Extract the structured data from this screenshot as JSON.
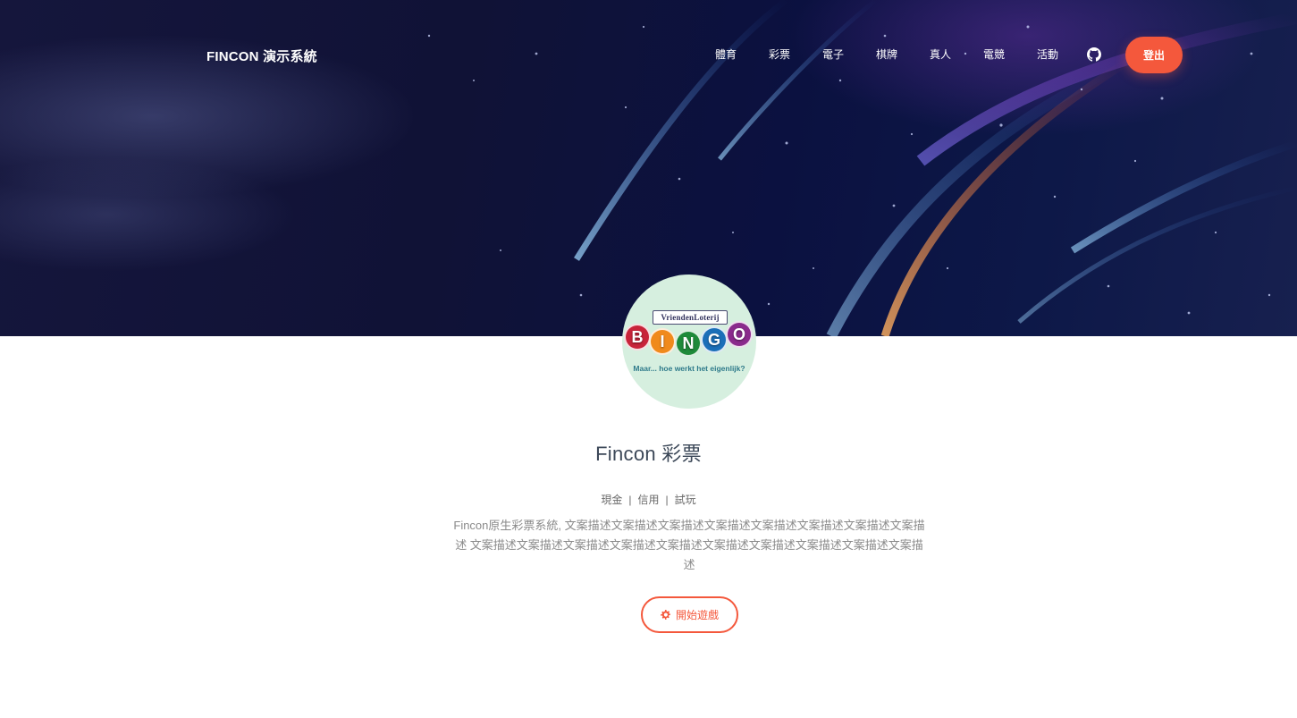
{
  "brand": {
    "name": "FINCON 演示系統"
  },
  "nav": {
    "items": [
      {
        "label": "體育"
      },
      {
        "label": "彩票"
      },
      {
        "label": "電子"
      },
      {
        "label": "棋牌"
      },
      {
        "label": "真人"
      },
      {
        "label": "電競"
      },
      {
        "label": "活動"
      }
    ],
    "github_icon": "github-icon",
    "logout_label": "登出"
  },
  "avatar": {
    "top_text": "VriendenLoterij",
    "balls": [
      "B",
      "I",
      "N",
      "G",
      "O"
    ],
    "subtitle": "Maar... hoe werkt het eigenlijk?"
  },
  "game": {
    "title": "Fincon 彩票",
    "modes": [
      "現金",
      "信用",
      "試玩"
    ],
    "description": "Fincon原生彩票系統, 文案描述文案描述文案描述文案描述文案描述文案描述文案描述文案描述 文案描述文案描述文案描述文案描述文案描述文案描述文案描述文案描述文案描述文案描述",
    "start_label": "開始遊戲",
    "start_icon": "gear-icon"
  },
  "colors": {
    "accent": "#f4583c",
    "hero_bg": "#101236",
    "title_text": "#3c4858",
    "body_text": "#8a8a8a"
  }
}
